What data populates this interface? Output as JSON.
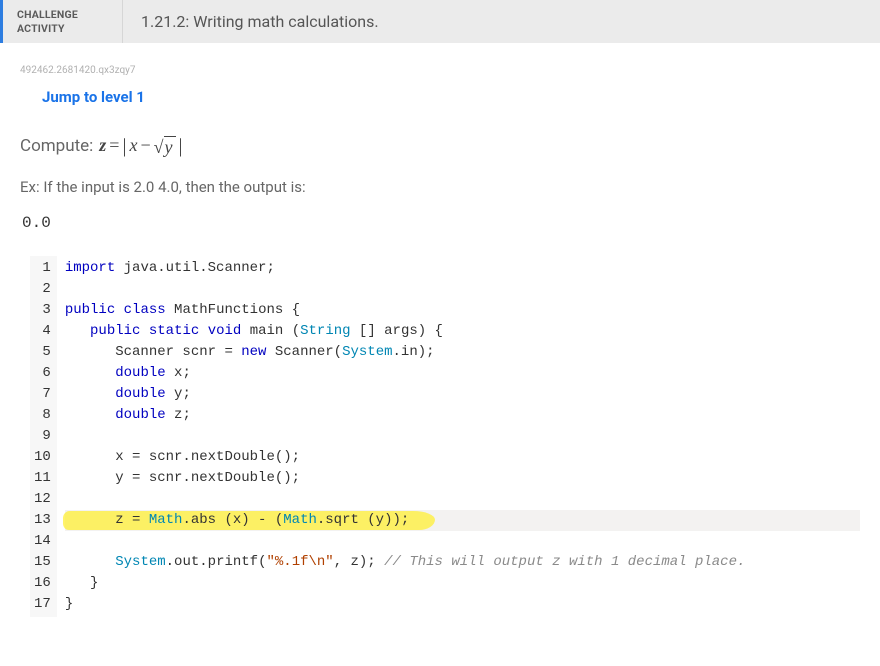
{
  "header": {
    "type_line1": "CHALLENGE",
    "type_line2": "ACTIVITY",
    "title": "1.21.2: Writing math calculations."
  },
  "meta_id": "492462.2681420.qx3zqy7",
  "jump_label": "Jump to level 1",
  "compute_prefix": "Compute:",
  "formula": {
    "lhs": "z",
    "eq": "=",
    "abs_open": "|",
    "x": "x",
    "minus": "−",
    "sqrt_radicand": "y",
    "abs_close": "|"
  },
  "example_text": "Ex: If the input is 2.0 4.0, then the output is:",
  "example_output": "0.0",
  "code": {
    "lines": [
      {
        "n": 1,
        "tokens": [
          [
            "kw",
            "import"
          ],
          [
            "",
            " java.util.Scanner;"
          ]
        ]
      },
      {
        "n": 2,
        "tokens": []
      },
      {
        "n": 3,
        "tokens": [
          [
            "kw",
            "public"
          ],
          [
            "",
            " "
          ],
          [
            "kw",
            "class"
          ],
          [
            "",
            " MathFunctions {"
          ]
        ]
      },
      {
        "n": 4,
        "tokens": [
          [
            "",
            "   "
          ],
          [
            "kw",
            "public"
          ],
          [
            "",
            " "
          ],
          [
            "kw",
            "static"
          ],
          [
            "",
            " "
          ],
          [
            "kw",
            "void"
          ],
          [
            "",
            " main ("
          ],
          [
            "type",
            "String"
          ],
          [
            "",
            " [] args) {"
          ]
        ]
      },
      {
        "n": 5,
        "tokens": [
          [
            "",
            "      Scanner scnr = "
          ],
          [
            "kw",
            "new"
          ],
          [
            "",
            " Scanner("
          ],
          [
            "type",
            "System"
          ],
          [
            "",
            ".in);"
          ]
        ]
      },
      {
        "n": 6,
        "tokens": [
          [
            "",
            "      "
          ],
          [
            "kw",
            "double"
          ],
          [
            "",
            " x;"
          ]
        ]
      },
      {
        "n": 7,
        "tokens": [
          [
            "",
            "      "
          ],
          [
            "kw",
            "double"
          ],
          [
            "",
            " y;"
          ]
        ]
      },
      {
        "n": 8,
        "tokens": [
          [
            "",
            "      "
          ],
          [
            "kw",
            "double"
          ],
          [
            "",
            " z;"
          ]
        ]
      },
      {
        "n": 9,
        "tokens": []
      },
      {
        "n": 10,
        "tokens": [
          [
            "",
            "      x = scnr.nextDouble();"
          ]
        ]
      },
      {
        "n": 11,
        "tokens": [
          [
            "",
            "      y = scnr.nextDouble();"
          ]
        ]
      },
      {
        "n": 12,
        "tokens": []
      },
      {
        "n": 13,
        "hl": true,
        "tokens": [
          [
            "",
            "      z = "
          ],
          [
            "type",
            "Math"
          ],
          [
            "",
            ".abs (x) - ("
          ],
          [
            "type",
            "Math"
          ],
          [
            "",
            ".sqrt (y));"
          ]
        ]
      },
      {
        "n": 14,
        "tokens": []
      },
      {
        "n": 15,
        "tokens": [
          [
            "",
            "      "
          ],
          [
            "type",
            "System"
          ],
          [
            "",
            ".out.printf("
          ],
          [
            "str",
            "\"%.1f\\n\""
          ],
          [
            "",
            ", z); "
          ],
          [
            "cmt",
            "// This will output z with 1 decimal place."
          ]
        ]
      },
      {
        "n": 16,
        "tokens": [
          [
            "",
            "   }"
          ]
        ]
      },
      {
        "n": 17,
        "tokens": [
          [
            "",
            "}"
          ]
        ]
      }
    ]
  }
}
